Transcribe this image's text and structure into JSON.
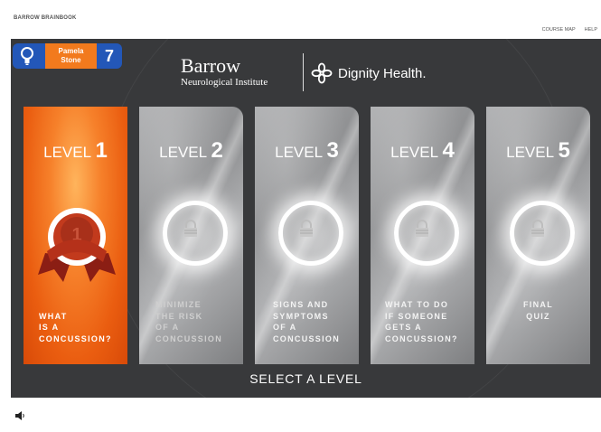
{
  "app": {
    "title": "BARROW BRAINBOOK"
  },
  "top_links": [
    "COURSE MAP",
    "HELP"
  ],
  "user": {
    "first_name": "Pamela",
    "last_name": "Stone",
    "score": "7"
  },
  "logos": {
    "barrow_main": "Barrow",
    "barrow_sub": "Neurological Institute",
    "dignity": "Dignity Health."
  },
  "levels": [
    {
      "word": "LEVEL",
      "num": "1",
      "title": [
        "WHAT",
        "IS A",
        "CONCUSSION?"
      ],
      "state": "active"
    },
    {
      "word": "LEVEL",
      "num": "2",
      "title": [
        "MINIMIZE",
        "THE RISK",
        "OF A",
        "CONCUSSION"
      ],
      "state": "locked"
    },
    {
      "word": "LEVEL",
      "num": "3",
      "title": [
        "SIGNS AND",
        "SYMPTOMS",
        "OF A",
        "CONCUSSION"
      ],
      "state": "locked"
    },
    {
      "word": "LEVEL",
      "num": "4",
      "title": [
        "WHAT TO DO",
        "IF SOMEONE",
        "GETS A",
        "CONCUSSION?"
      ],
      "state": "locked"
    },
    {
      "word": "LEVEL",
      "num": "5",
      "title": [
        "FINAL",
        "QUIZ"
      ],
      "state": "locked"
    }
  ],
  "footer": {
    "select_label": "SELECT A LEVEL"
  },
  "icons": {
    "bulb": "lightbulb-icon",
    "lock": "lock-icon",
    "medal": "ribbon-medal-icon",
    "speaker": "speaker-icon"
  },
  "colors": {
    "orange": "#f27a1d",
    "blue": "#2357b8",
    "stage": "#38393b"
  }
}
